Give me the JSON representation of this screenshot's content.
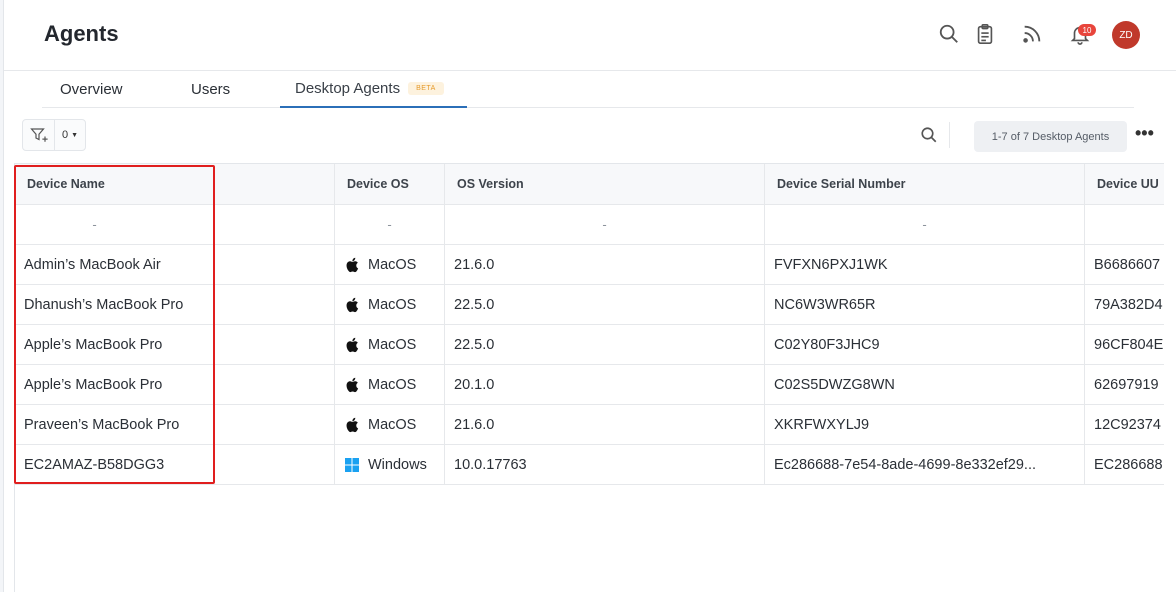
{
  "header": {
    "title": "Agents",
    "notification_count": "10",
    "avatar_initials": "ZD"
  },
  "tabs": [
    {
      "label": "Overview"
    },
    {
      "label": "Users"
    },
    {
      "label": "Desktop Agents",
      "badge": "BETA",
      "active": true
    }
  ],
  "toolbar": {
    "filter_count": "0",
    "record_count": "1-7 of 7 Desktop Agents"
  },
  "table": {
    "columns": [
      "Device Name",
      "Device OS",
      "OS Version",
      "Device Serial Number",
      "Device UU"
    ],
    "rows": [
      {
        "name": "-",
        "os": "-",
        "os_icon": "",
        "version": "-",
        "serial": "-",
        "uuid": ""
      },
      {
        "name": "Admin’s MacBook Air",
        "os": "MacOS",
        "os_icon": "apple-icon",
        "version": "21.6.0",
        "serial": "FVFXN6PXJ1WK",
        "uuid": "B6686607"
      },
      {
        "name": "Dhanush’s MacBook Pro",
        "os": "MacOS",
        "os_icon": "apple-icon",
        "version": "22.5.0",
        "serial": "NC6W3WR65R",
        "uuid": "79A382D4"
      },
      {
        "name": "Apple’s MacBook Pro",
        "os": "MacOS",
        "os_icon": "apple-icon",
        "version": "22.5.0",
        "serial": "C02Y80F3JHC9",
        "uuid": "96CF804E"
      },
      {
        "name": "Apple’s MacBook Pro",
        "os": "MacOS",
        "os_icon": "apple-icon",
        "version": "20.1.0",
        "serial": "C02S5DWZG8WN",
        "uuid": "62697919"
      },
      {
        "name": "Praveen’s MacBook Pro",
        "os": "MacOS",
        "os_icon": "apple-icon",
        "version": "21.6.0",
        "serial": "XKRFWXYLJ9",
        "uuid": "12C92374"
      },
      {
        "name": "EC2AMAZ-B58DGG3",
        "os": "Windows",
        "os_icon": "windows-icon",
        "version": "10.0.17763",
        "serial": "Ec286688-7e54-8ade-4699-8e332ef29...",
        "uuid": "EC286688"
      }
    ]
  },
  "colors": {
    "accent": "#2b6fb8",
    "highlight": "#e01e1e",
    "badge": "#e8453c",
    "avatar": "#c0392b",
    "windows": "#1aa1f1"
  }
}
